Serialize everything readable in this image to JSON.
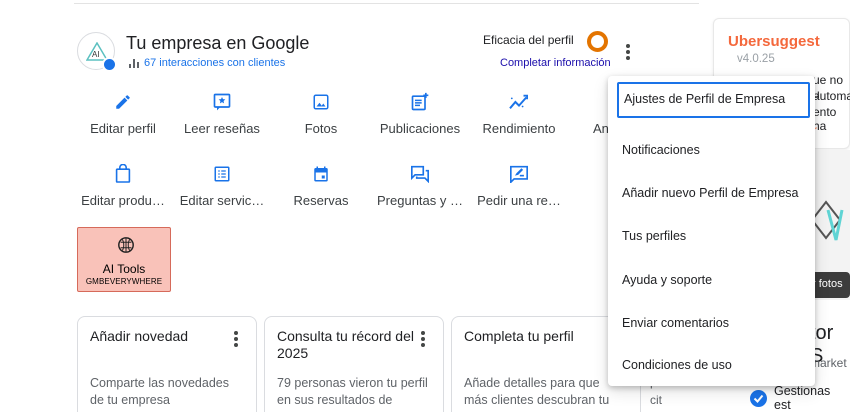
{
  "business": {
    "title": "Tu empresa en Google",
    "interactions": "67 interacciones con clientes",
    "efficacy_label": "Eficacia del perfil",
    "complete_link": "Completar información"
  },
  "actions_row1": [
    {
      "label": "Editar perfil",
      "icon": "pencil-icon"
    },
    {
      "label": "Leer reseñas",
      "icon": "star-review-icon"
    },
    {
      "label": "Fotos",
      "icon": "photo-icon"
    },
    {
      "label": "Publicaciones",
      "icon": "post-add-icon"
    },
    {
      "label": "Rendimiento",
      "icon": "trending-icon"
    },
    {
      "label": "An",
      "icon": "ads-icon"
    }
  ],
  "actions_row2": [
    {
      "label": "Editar produ…",
      "icon": "shopping-bag-icon"
    },
    {
      "label": "Editar servic…",
      "icon": "list-icon"
    },
    {
      "label": "Reservas",
      "icon": "calendar-icon"
    },
    {
      "label": "Preguntas y …",
      "icon": "forum-icon"
    },
    {
      "label": "Pedir una re…",
      "icon": "rate-review-icon"
    }
  ],
  "ai_tools": {
    "title": "AI Tools",
    "subtitle": "GMBEVERYWHERE"
  },
  "cards": [
    {
      "title": "Añadir novedad",
      "body": "Comparte las novedades de tu empresa"
    },
    {
      "title": "Consulta tu récord del 2025",
      "body": "79 personas vieron tu perfil en sus resultados de"
    },
    {
      "title": "Completa tu perfil",
      "body": "Añade detalles para que más clientes descubran tu"
    }
  ],
  "ubersuggest": {
    "name": "Ubersuggest",
    "version": "v4.0.25",
    "lines": [
      "ue no u",
      "automa",
      "ento ha"
    ],
    "link_fragment": "r"
  },
  "right_side": {
    "photos_button": "r fotos",
    "heading_fragment": "tor S",
    "market_fragment": "market",
    "managed": "Gestionas est",
    "partial_lines": [
      "p",
      "cit"
    ]
  },
  "menu": {
    "items": [
      "Ajustes de Perfil de Empresa",
      "Notificaciones",
      "Añadir nuevo Perfil de Empresa",
      "Tus perfiles",
      "Ayuda y soporte",
      "Enviar comentarios",
      "Condiciones de uso"
    ]
  },
  "colors": {
    "accent": "#1a73e8",
    "ubersuggest": "#f4683c",
    "ai_tools_bg": "#f9c2b9",
    "donut": "#e37400"
  }
}
